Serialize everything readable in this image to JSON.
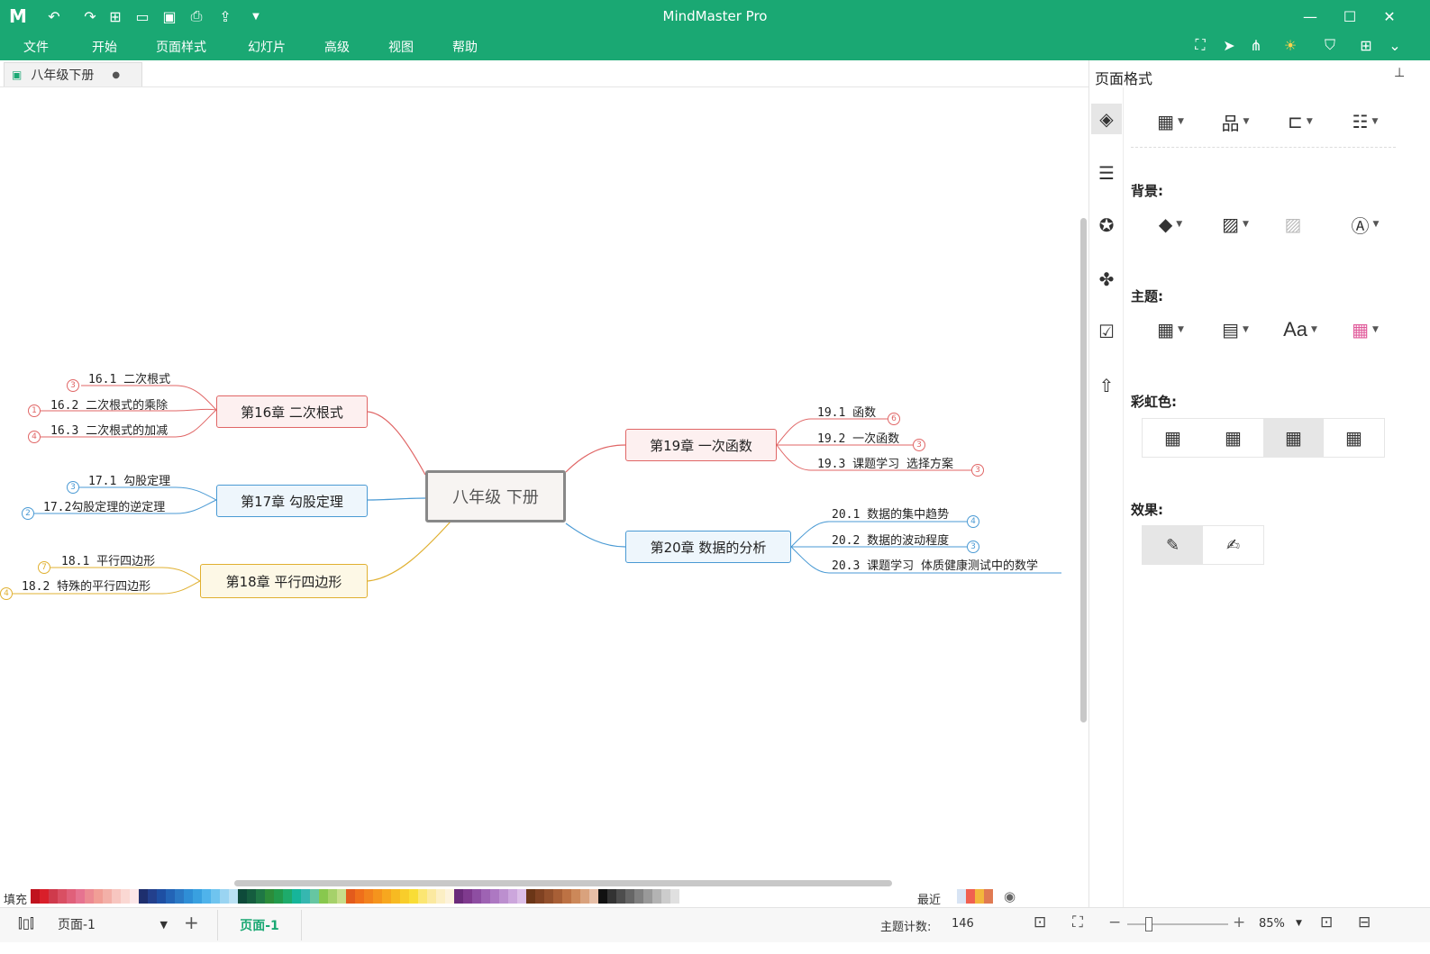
{
  "app": {
    "title": "MindMaster Pro"
  },
  "menu": [
    "文件",
    "开始",
    "页面样式",
    "幻灯片",
    "高级",
    "视图",
    "帮助"
  ],
  "tab": {
    "label": "八年级下册"
  },
  "panel": {
    "title": "页面格式",
    "background_label": "背景:",
    "theme_label": "主题:",
    "rainbow_label": "彩虹色:",
    "effect_label": "效果:"
  },
  "mindmap": {
    "root": "八年级  下册",
    "branches": [
      {
        "label": "第16章  二次根式",
        "color": "#e06666",
        "children": [
          {
            "text": "16.1  二次根式",
            "badge": "3"
          },
          {
            "text": "16.2  二次根式的乘除",
            "badge": "1"
          },
          {
            "text": "16.3  二次根式的加减",
            "badge": "4"
          }
        ]
      },
      {
        "label": "第17章  勾股定理",
        "color": "#4a9ad4",
        "children": [
          {
            "text": "17.1  勾股定理",
            "badge": "3"
          },
          {
            "text": "17.2勾股定理的逆定理",
            "badge": "2"
          }
        ]
      },
      {
        "label": "第18章  平行四边形",
        "color": "#e0b030",
        "children": [
          {
            "text": "18.1  平行四边形",
            "badge": "7"
          },
          {
            "text": "18.2  特殊的平行四边形",
            "badge": "4"
          }
        ]
      },
      {
        "label": "第19章  一次函数",
        "color": "#e06666",
        "children": [
          {
            "text": "19.1  函数",
            "badge": "6"
          },
          {
            "text": "19.2  一次函数",
            "badge": "3"
          },
          {
            "text": "19.3  课题学习  选择方案",
            "badge": "3"
          }
        ]
      },
      {
        "label": "第20章  数据的分析",
        "color": "#4a9ad4",
        "children": [
          {
            "text": "20.1  数据的集中趋势",
            "badge": "4"
          },
          {
            "text": "20.2  数据的波动程度",
            "badge": "3"
          },
          {
            "text": "20.3  课题学习  体质健康测试中的数学",
            "badge": ""
          }
        ]
      }
    ]
  },
  "palette": {
    "fill_label": "填充",
    "recent_label": "最近"
  },
  "status": {
    "page_select": "页面-1",
    "page_tab": "页面-1",
    "topic_count_label": "主题计数:",
    "topic_count": "146",
    "zoom": "85%"
  },
  "colors": {
    "brand": "#1aa873"
  }
}
